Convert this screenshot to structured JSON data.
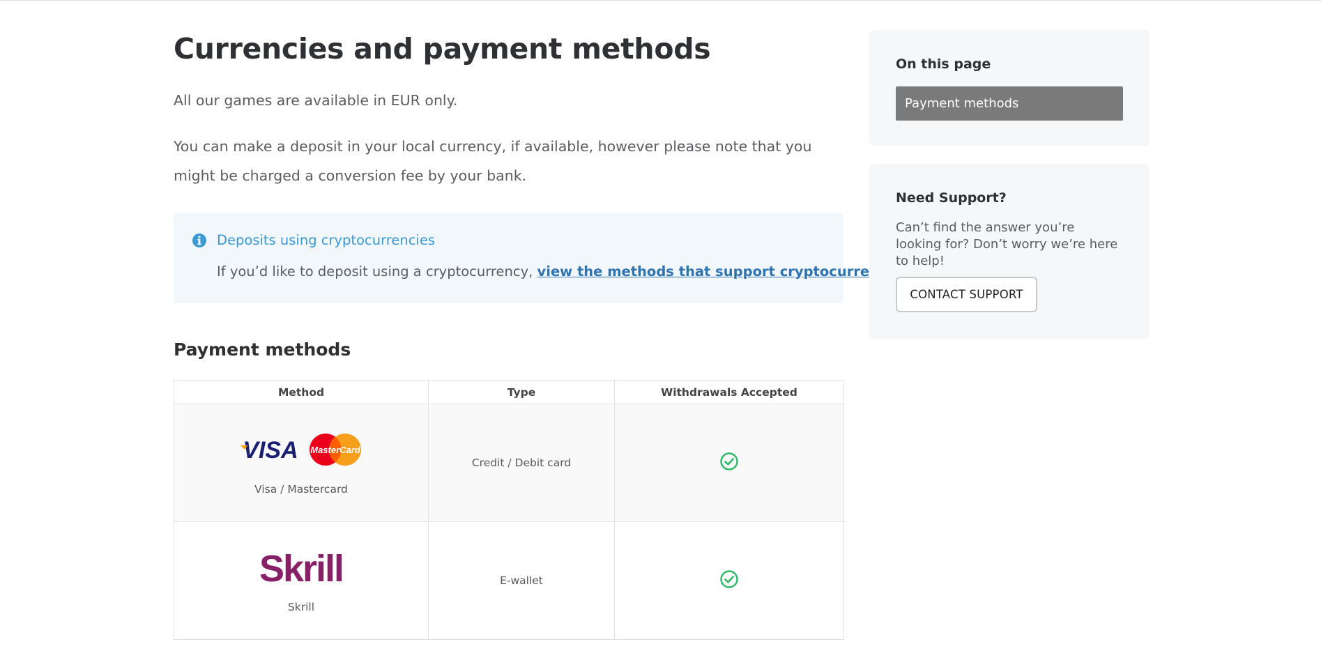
{
  "page": {
    "title": "Currencies and payment methods",
    "intro": "All our games are available in EUR only.",
    "deposit_note": "You can make a deposit in your local currency, if available, however please note that you might be charged a conversion fee by your bank."
  },
  "notice": {
    "icon": "info-icon",
    "title": "Deposits using cryptocurrencies",
    "body_prefix": "If you’d like to deposit using a cryptocurrency, ",
    "link_text": "view the methods that support cryptocurrencies"
  },
  "payment_section": {
    "title": "Payment methods",
    "columns": [
      "Method",
      "Type",
      "Withdrawals Accepted"
    ],
    "rows": [
      {
        "logos": [
          "VISA",
          "MasterCard"
        ],
        "method": "Visa / Mastercard",
        "type": "Credit / Debit card",
        "withdrawals_icon": "check-circle-icon"
      },
      {
        "logos": [
          "Skrill"
        ],
        "method": "Skrill",
        "type": "E-wallet",
        "withdrawals_icon": "check-circle-icon"
      }
    ]
  },
  "sidebar": {
    "toc_title": "On this page",
    "toc_items": [
      "Payment methods"
    ],
    "support_title": "Need Support?",
    "support_text": "Can’t find the answer you’re looking for? Don’t worry we’re here to help!",
    "contact_button": "CONTACT SUPPORT"
  },
  "colors": {
    "accent_blue": "#3b99d3",
    "link_blue": "#2e73b0",
    "check_green": "#2fb866",
    "skrill_purple": "#862165",
    "visa_blue": "#1a1f71"
  }
}
